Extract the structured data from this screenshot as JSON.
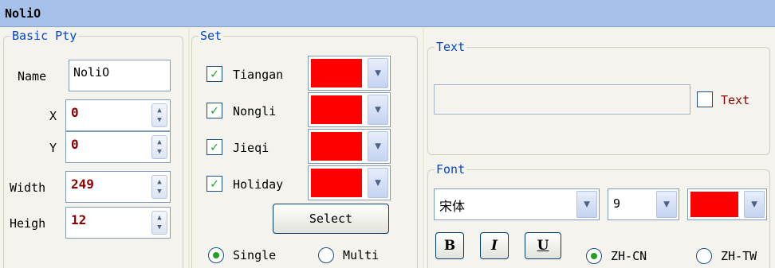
{
  "window": {
    "title": "NoliO"
  },
  "basic": {
    "legend": "Basic Pty",
    "name_label": "Name",
    "name_value": "NoliO",
    "x_label": "X",
    "x_value": "0",
    "y_label": "Y",
    "y_value": "0",
    "width_label": "Width",
    "width_value": "249",
    "height_label": "Heigh",
    "height_value": "12"
  },
  "set": {
    "legend": "Set",
    "items": [
      {
        "label": "Tiangan",
        "checked": true,
        "color": "#ff0000"
      },
      {
        "label": "Nongli",
        "checked": true,
        "color": "#ff0000"
      },
      {
        "label": "Jieqi",
        "checked": true,
        "color": "#ff0000"
      },
      {
        "label": "Holiday",
        "checked": true,
        "color": "#ff0000"
      }
    ],
    "select_label": "Select",
    "single_label": "Single",
    "multi_label": "Multi",
    "mode_selected": "Single"
  },
  "text": {
    "legend": "Text",
    "value": "",
    "check_label": "Text",
    "checked": false
  },
  "font": {
    "legend": "Font",
    "family": "宋体",
    "size": "9",
    "color": "#ff0000",
    "bold_label": "B",
    "italic_label": "I",
    "underline_label": "U",
    "zhcn_label": "ZH-CN",
    "zhtw_label": "ZH-TW",
    "lang_selected": "ZH-CN"
  },
  "icons": {
    "spin": "spin-arrows-icon",
    "dropdown": "chevron-down-icon",
    "check": "checkmark-icon"
  }
}
